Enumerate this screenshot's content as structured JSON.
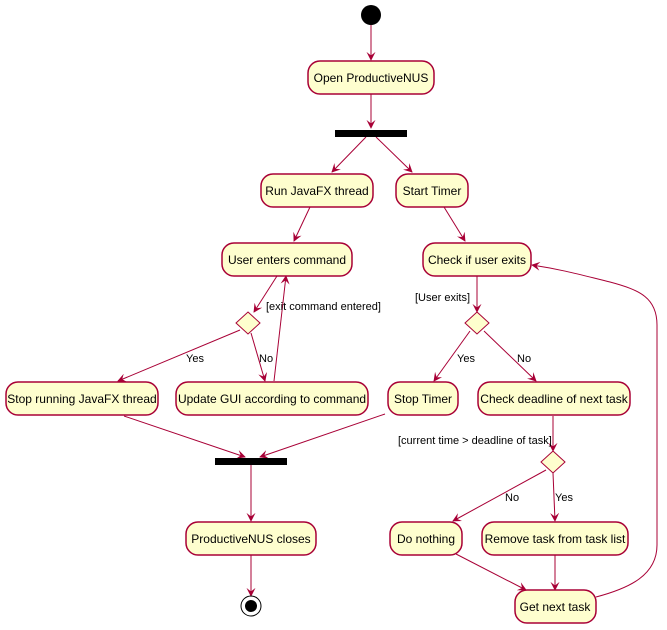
{
  "diagram": {
    "type": "uml-activity",
    "colors": {
      "node_fill": "#FEFECE",
      "node_border": "#A80036",
      "edge": "#A80036",
      "bar": "#000000",
      "start": "#000000"
    },
    "nodes": {
      "open": "Open ProductiveNUS",
      "run_javafx": "Run JavaFX thread",
      "start_timer": "Start Timer",
      "user_enters": "User enters command",
      "check_exit": "Check if user exits",
      "stop_javafx": "Stop running JavaFX thread",
      "update_gui": "Update GUI according to command",
      "stop_timer": "Stop Timer",
      "check_deadline": "Check deadline of next task",
      "closes": "ProductiveNUS closes",
      "do_nothing": "Do nothing",
      "remove_task": "Remove task from task list",
      "get_next": "Get next task"
    },
    "labels": {
      "exit_cmd": "[exit command entered]",
      "user_exits": "[User exits]",
      "deadline_cond": "[current time > deadline of task]",
      "yes1": "Yes",
      "no1": "No",
      "yes2": "Yes",
      "no2": "No",
      "yes3": "Yes",
      "no3": "No"
    }
  }
}
